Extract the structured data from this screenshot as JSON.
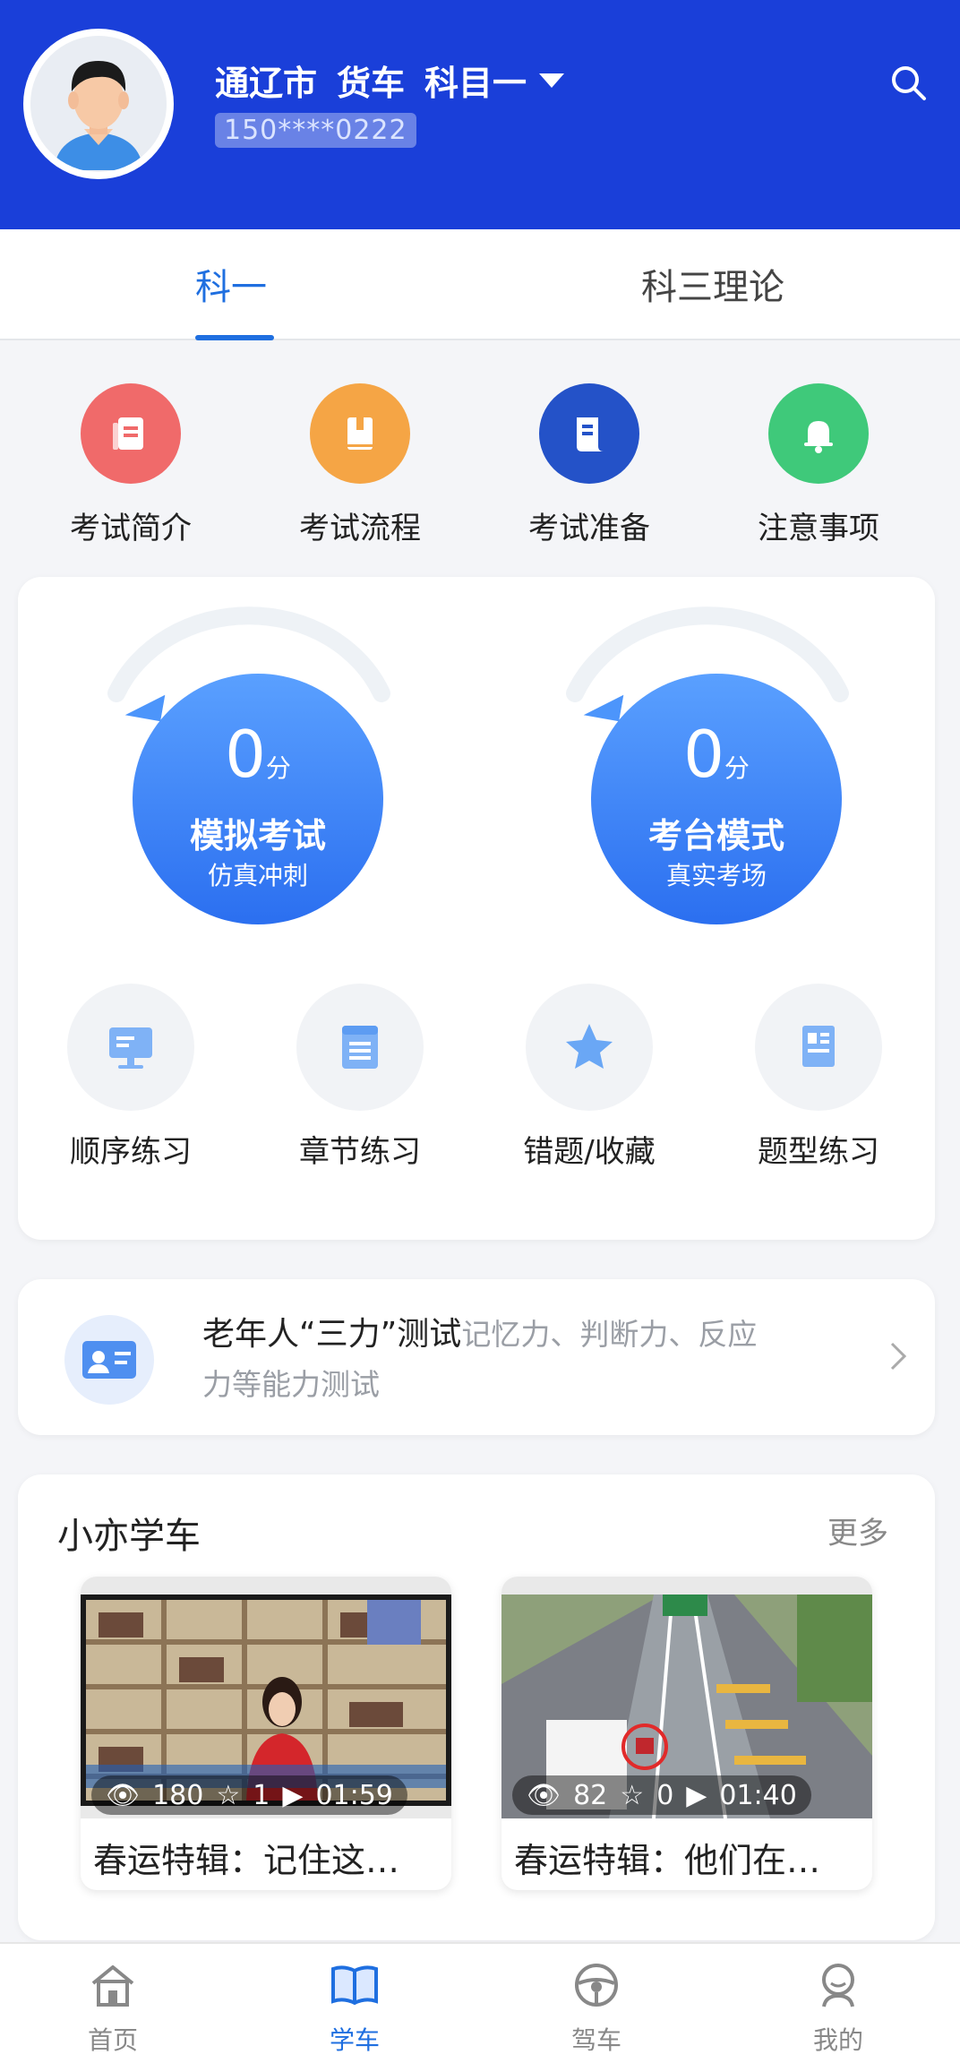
{
  "header": {
    "city": "通辽市",
    "vehicle": "货车",
    "subject": "科目一",
    "phone": "150****0222",
    "bg_color": "#1a3fd9",
    "search_icon": "search-icon"
  },
  "tabs": [
    {
      "label": "科一",
      "active": true
    },
    {
      "label": "科三理论",
      "active": false
    }
  ],
  "quick_links": [
    {
      "label": "考试简介",
      "icon": "document-icon",
      "color": "#f06a6a"
    },
    {
      "label": "考试流程",
      "icon": "book-icon",
      "color": "#f5a545"
    },
    {
      "label": "考试准备",
      "icon": "scroll-icon",
      "color": "#2452c8"
    },
    {
      "label": "注意事项",
      "icon": "bell-icon",
      "color": "#3fc97a"
    }
  ],
  "exam_modes": [
    {
      "score": "0",
      "unit": "分",
      "title": "模拟考试",
      "subtitle": "仿真冲刺"
    },
    {
      "score": "0",
      "unit": "分",
      "title": "考台模式",
      "subtitle": "真实考场"
    }
  ],
  "practice": [
    {
      "label": "顺序练习",
      "icon": "monitor-icon"
    },
    {
      "label": "章节练习",
      "icon": "list-icon"
    },
    {
      "label": "错题/收藏",
      "icon": "star-icon"
    },
    {
      "label": "题型练习",
      "icon": "notebook-icon"
    }
  ],
  "elderly_test": {
    "title": "老年人“三力”测试",
    "desc_inline": "记忆力、判断力、反应",
    "desc_wrap": "力等能力测试",
    "icon": "id-card-icon"
  },
  "learning": {
    "title": "小亦学车",
    "more": "更多",
    "videos": [
      {
        "views": "180",
        "stars": "1",
        "duration": "01:59",
        "title": "春运特辑：记住这…"
      },
      {
        "views": "82",
        "stars": "0",
        "duration": "01:40",
        "title": "春运特辑：他们在…"
      }
    ]
  },
  "bottom_nav": [
    {
      "label": "首页",
      "icon": "home-icon",
      "active": false
    },
    {
      "label": "学车",
      "icon": "open-book-icon",
      "active": true
    },
    {
      "label": "驾车",
      "icon": "steering-wheel-icon",
      "active": false
    },
    {
      "label": "我的",
      "icon": "profile-icon",
      "active": false
    }
  ],
  "accent_color": "#1f6fe0"
}
